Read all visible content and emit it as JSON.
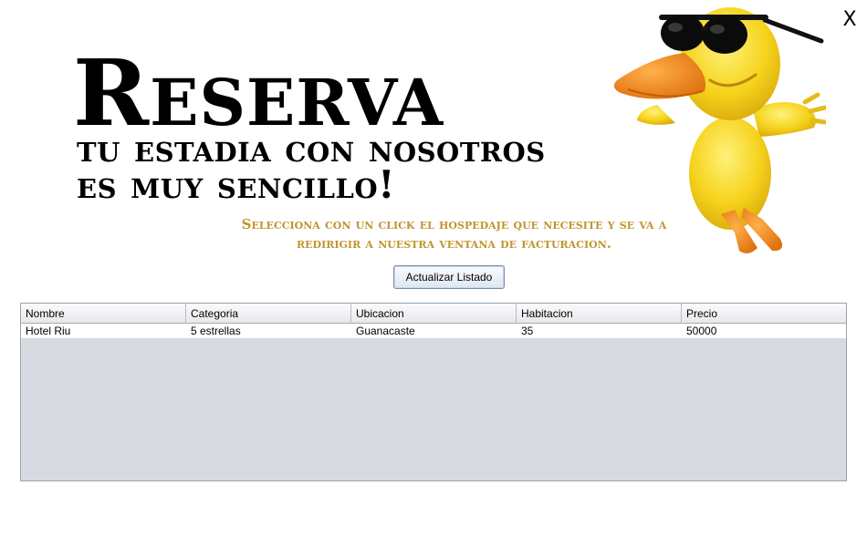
{
  "window": {
    "close_label": "X"
  },
  "hero": {
    "title": "Reserva",
    "subtitle_line1": "tu estadia con nosotros",
    "subtitle_line2": "es muy sencillo!",
    "tagline_line1": "Selecciona con un click el hospedaje que necesite y se va a",
    "tagline_line2": "redirigir a nuestra ventana de facturacion."
  },
  "toolbar": {
    "refresh_label": "Actualizar Listado"
  },
  "table": {
    "columns": [
      "Nombre",
      "Categoria",
      "Ubicacion",
      "Habitacion",
      "Precio"
    ],
    "rows": [
      [
        "Hotel Riu",
        "5 estrellas",
        "Guanacaste",
        "35",
        "50000"
      ]
    ]
  },
  "colors": {
    "tagline": "#c0952e",
    "duck_body": "#f5d21b",
    "duck_beak": "#f08a1e",
    "table_empty_bg": "#d8dae1"
  },
  "icons": {
    "close": "close-icon",
    "mascot": "duck-mascot-illustration"
  }
}
